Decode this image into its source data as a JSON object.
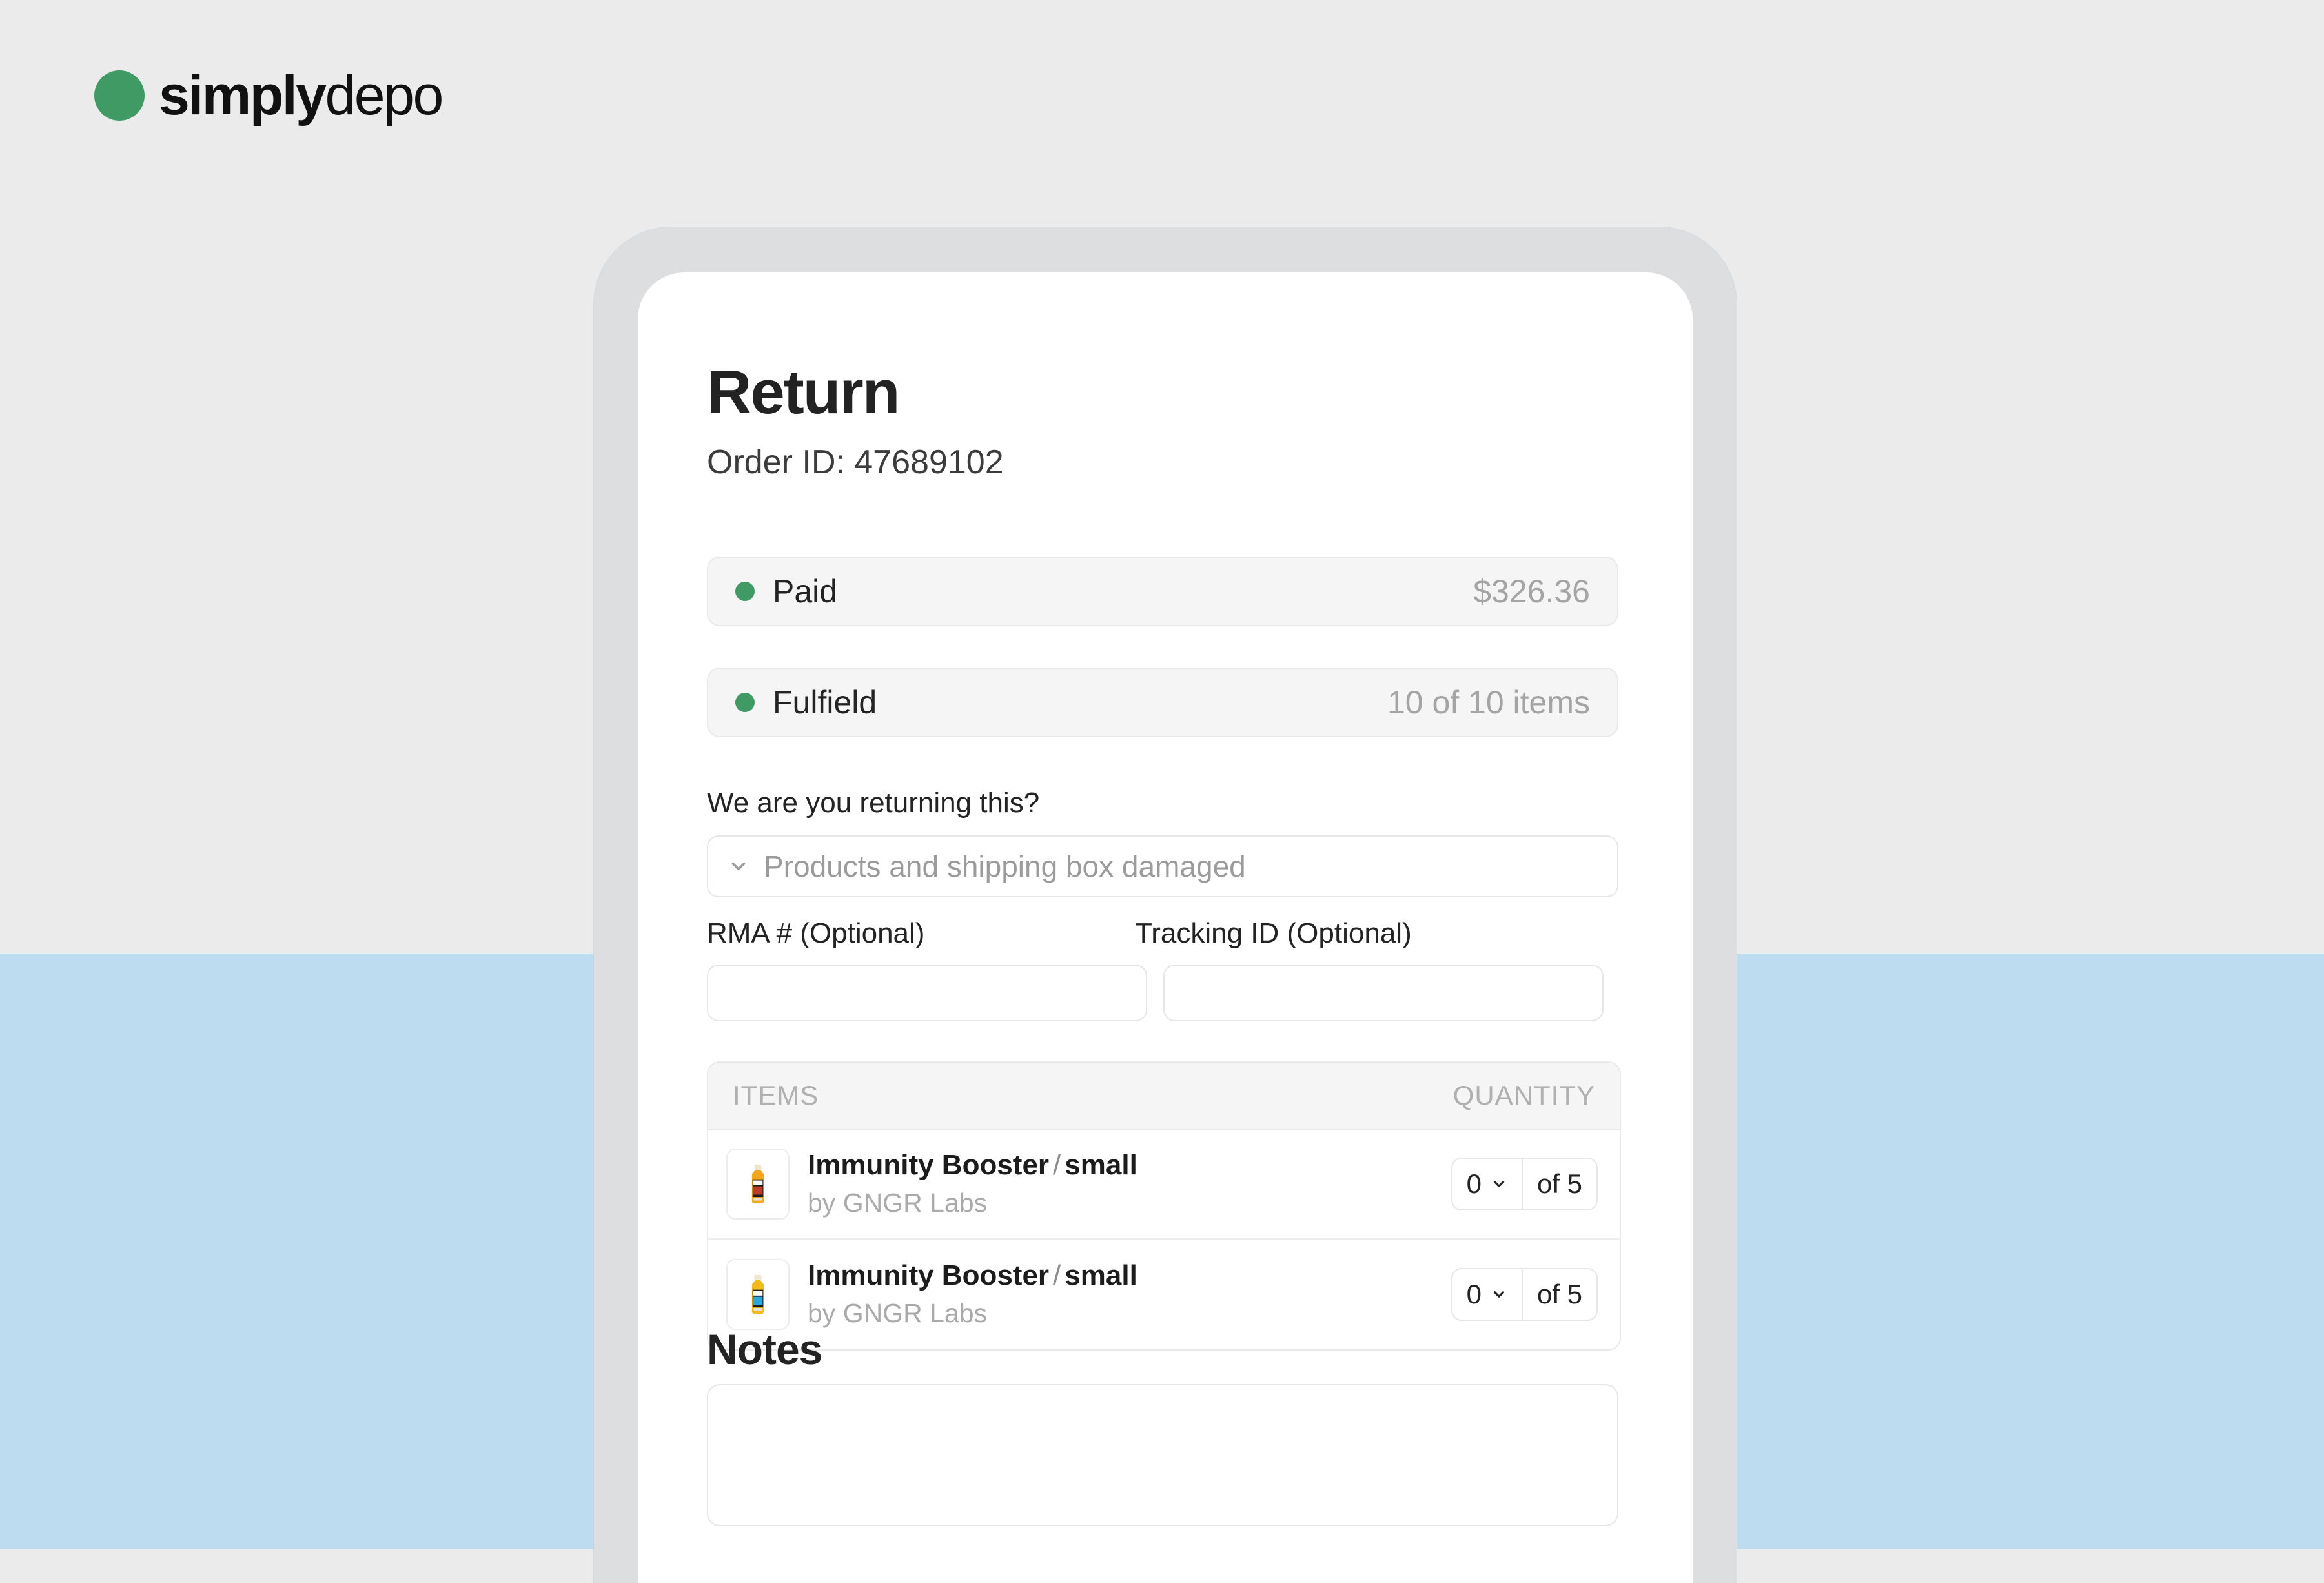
{
  "brand": {
    "name_bold": "simply",
    "name_light": "depo",
    "mark_color": "#3f9a63"
  },
  "theme": {
    "background_top": "#ebebec",
    "background_bottom": "#bedcef",
    "device_bezel": "#dcdee0",
    "screen": "#ffffff",
    "accent_green": "#3f9a63",
    "muted_text": "#a4a4a4"
  },
  "screen": {
    "title": "Return",
    "order_id": "Order ID: 47689102",
    "status": [
      {
        "label": "Paid",
        "value": "$326.36",
        "dot_color": "#3f9a63"
      },
      {
        "label": "Fulfield",
        "value": "10 of 10 items",
        "dot_color": "#3f9a63"
      }
    ],
    "reason": {
      "label": "We are you returning this?",
      "value": "Products and shipping box damaged",
      "chevron_icon": "chevron-down-icon"
    },
    "fields": [
      {
        "label": "RMA # (Optional)",
        "value": "",
        "placeholder": ""
      },
      {
        "label": "Tracking ID (Optional)",
        "value": "",
        "placeholder": ""
      }
    ],
    "items_table": {
      "columns": [
        "ITEMS",
        "QUANTITY"
      ],
      "rows": [
        {
          "name": "Immunity Booster",
          "separator": "/",
          "variant": "small",
          "brand": "by GNGR Labs",
          "qty_selected": "0",
          "qty_total": "of 5",
          "thumb_label_color": "#c0392b",
          "thumb_bottle_color": "#f1a81b"
        },
        {
          "name": "Immunity Booster",
          "separator": "/",
          "variant": "small",
          "brand": "by GNGR Labs",
          "qty_selected": "0",
          "qty_total": "of 5",
          "thumb_label_color": "#2aa6de",
          "thumb_bottle_color": "#f1b91b"
        }
      ]
    },
    "notes": {
      "title": "Notes",
      "value": "",
      "placeholder": ""
    }
  }
}
